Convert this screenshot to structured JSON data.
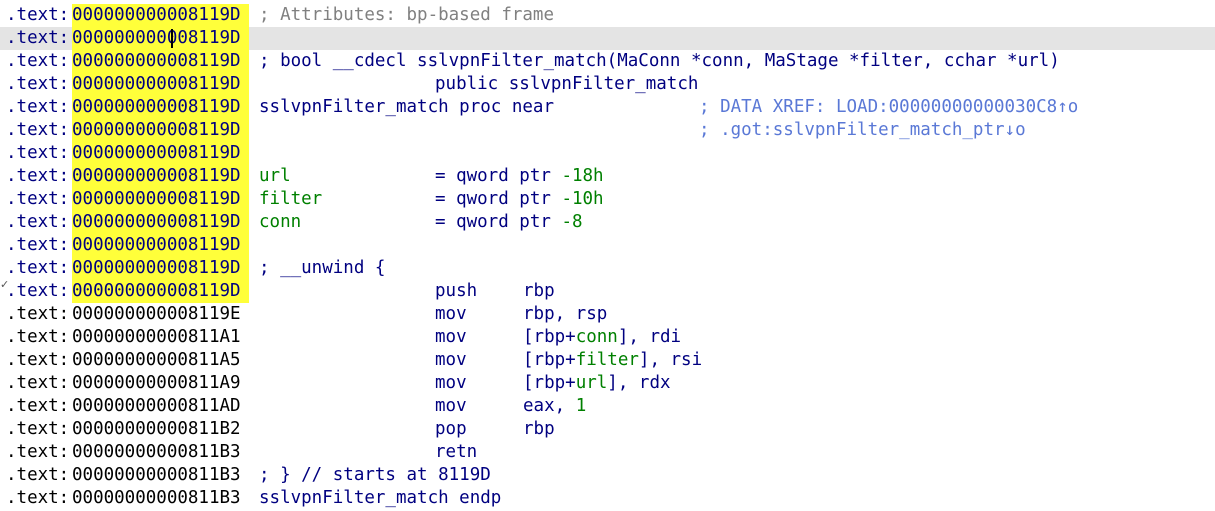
{
  "listing": {
    "rows": [
      {
        "style": "hl",
        "seg": ".text:",
        "addr": "000000000008119D",
        "parts": [
          {
            "text": "; Attributes: bp-based frame",
            "col": "c1",
            "cls": "c-gray"
          }
        ]
      },
      {
        "style": "hl current",
        "seg": ".text:",
        "addr": "000000000008119D",
        "caret": true,
        "parts": []
      },
      {
        "style": "hl",
        "seg": ".text:",
        "addr": "000000000008119D",
        "parts": [
          {
            "text": "; bool __cdecl sslvpnFilter_match(MaConn *conn, MaStage *filter, cchar *url)",
            "col": "c1",
            "cls": "c-navy"
          }
        ]
      },
      {
        "style": "hl",
        "seg": ".text:",
        "addr": "000000000008119D",
        "parts": [
          {
            "text": "public sslvpnFilter_match",
            "col": "c2",
            "cls": "c-navy"
          }
        ]
      },
      {
        "style": "hl",
        "seg": ".text:",
        "addr": "000000000008119D",
        "parts": [
          {
            "text": "sslvpnFilter_match proc near",
            "col": "c1",
            "cls": "c-navy"
          },
          {
            "text": "; DATA XREF: LOAD:00000000000030C8↑o",
            "col": "c4",
            "cls": "c-blue"
          }
        ]
      },
      {
        "style": "hl",
        "seg": ".text:",
        "addr": "000000000008119D",
        "parts": [
          {
            "text": "; .got:sslvpnFilter_match_ptr↓o",
            "col": "c4",
            "cls": "c-blue"
          }
        ]
      },
      {
        "style": "hl",
        "seg": ".text:",
        "addr": "000000000008119D",
        "parts": []
      },
      {
        "style": "hl",
        "seg": ".text:",
        "addr": "000000000008119D",
        "parts": [
          {
            "text": "url",
            "col": "c1",
            "cls": "c-green"
          },
          {
            "text": "= qword ptr ",
            "col": "c2",
            "cls": "c-navy",
            "tail": {
              "text": "-18h",
              "cls": "c-green"
            }
          }
        ]
      },
      {
        "style": "hl",
        "seg": ".text:",
        "addr": "000000000008119D",
        "parts": [
          {
            "text": "filter",
            "col": "c1",
            "cls": "c-green"
          },
          {
            "text": "= qword ptr ",
            "col": "c2",
            "cls": "c-navy",
            "tail": {
              "text": "-10h",
              "cls": "c-green"
            }
          }
        ]
      },
      {
        "style": "hl",
        "seg": ".text:",
        "addr": "000000000008119D",
        "parts": [
          {
            "text": "conn",
            "col": "c1",
            "cls": "c-green"
          },
          {
            "text": "= qword ptr ",
            "col": "c2",
            "cls": "c-navy",
            "tail": {
              "text": "-8",
              "cls": "c-green"
            }
          }
        ]
      },
      {
        "style": "hl",
        "seg": ".text:",
        "addr": "000000000008119D",
        "parts": []
      },
      {
        "style": "hl",
        "seg": ".text:",
        "addr": "000000000008119D",
        "parts": [
          {
            "text": "; __unwind {",
            "col": "c1",
            "cls": "c-navy"
          }
        ]
      },
      {
        "style": "hl",
        "seg": ".text:",
        "addr": "000000000008119D",
        "parts": [
          {
            "text": "push",
            "col": "c2",
            "cls": "c-navy"
          },
          {
            "text": "rbp",
            "col": "c3",
            "cls": "c-navy"
          }
        ]
      },
      {
        "style": "plain",
        "seg": ".text:",
        "addr": "000000000008119E",
        "parts": [
          {
            "text": "mov",
            "col": "c2",
            "cls": "c-navy"
          },
          {
            "text": "rbp, rsp",
            "col": "c3",
            "cls": "c-navy"
          }
        ]
      },
      {
        "style": "plain",
        "seg": ".text:",
        "addr": "00000000000811A1",
        "parts": [
          {
            "text": "mov",
            "col": "c2",
            "cls": "c-navy"
          },
          {
            "text": "[rbp+",
            "col": "c3",
            "cls": "c-navy",
            "mid": {
              "text": "conn",
              "cls": "c-green"
            },
            "after": "], rdi"
          }
        ]
      },
      {
        "style": "plain",
        "seg": ".text:",
        "addr": "00000000000811A5",
        "parts": [
          {
            "text": "mov",
            "col": "c2",
            "cls": "c-navy"
          },
          {
            "text": "[rbp+",
            "col": "c3",
            "cls": "c-navy",
            "mid": {
              "text": "filter",
              "cls": "c-green"
            },
            "after": "], rsi"
          }
        ]
      },
      {
        "style": "plain",
        "seg": ".text:",
        "addr": "00000000000811A9",
        "parts": [
          {
            "text": "mov",
            "col": "c2",
            "cls": "c-navy"
          },
          {
            "text": "[rbp+",
            "col": "c3",
            "cls": "c-navy",
            "mid": {
              "text": "url",
              "cls": "c-green"
            },
            "after": "], rdx"
          }
        ]
      },
      {
        "style": "plain",
        "seg": ".text:",
        "addr": "00000000000811AD",
        "parts": [
          {
            "text": "mov",
            "col": "c2",
            "cls": "c-navy"
          },
          {
            "text": "eax, ",
            "col": "c3",
            "cls": "c-navy",
            "tail": {
              "text": "1",
              "cls": "c-green"
            }
          }
        ]
      },
      {
        "style": "plain",
        "seg": ".text:",
        "addr": "00000000000811B2",
        "parts": [
          {
            "text": "pop",
            "col": "c2",
            "cls": "c-navy"
          },
          {
            "text": "rbp",
            "col": "c3",
            "cls": "c-navy"
          }
        ]
      },
      {
        "style": "plain",
        "seg": ".text:",
        "addr": "00000000000811B3",
        "parts": [
          {
            "text": "retn",
            "col": "c2",
            "cls": "c-navy"
          }
        ]
      },
      {
        "style": "plain",
        "seg": ".text:",
        "addr": "00000000000811B3",
        "parts": [
          {
            "text": "; } // starts at 8119D",
            "col": "c1",
            "cls": "c-navy"
          }
        ]
      },
      {
        "style": "plain",
        "seg": ".text:",
        "addr": "00000000000811B3",
        "parts": [
          {
            "text": "sslvpnFilter_match endp",
            "col": "c1",
            "cls": "c-navy"
          }
        ]
      }
    ]
  },
  "colors": {
    "address_highlight": "#ffff3a",
    "current_line": "#e4e4e4",
    "text_navy": "#000080",
    "text_green": "#008000",
    "comment_gray": "#808080",
    "xref_blue": "#5a78d6"
  },
  "marker_glyph": "✓"
}
